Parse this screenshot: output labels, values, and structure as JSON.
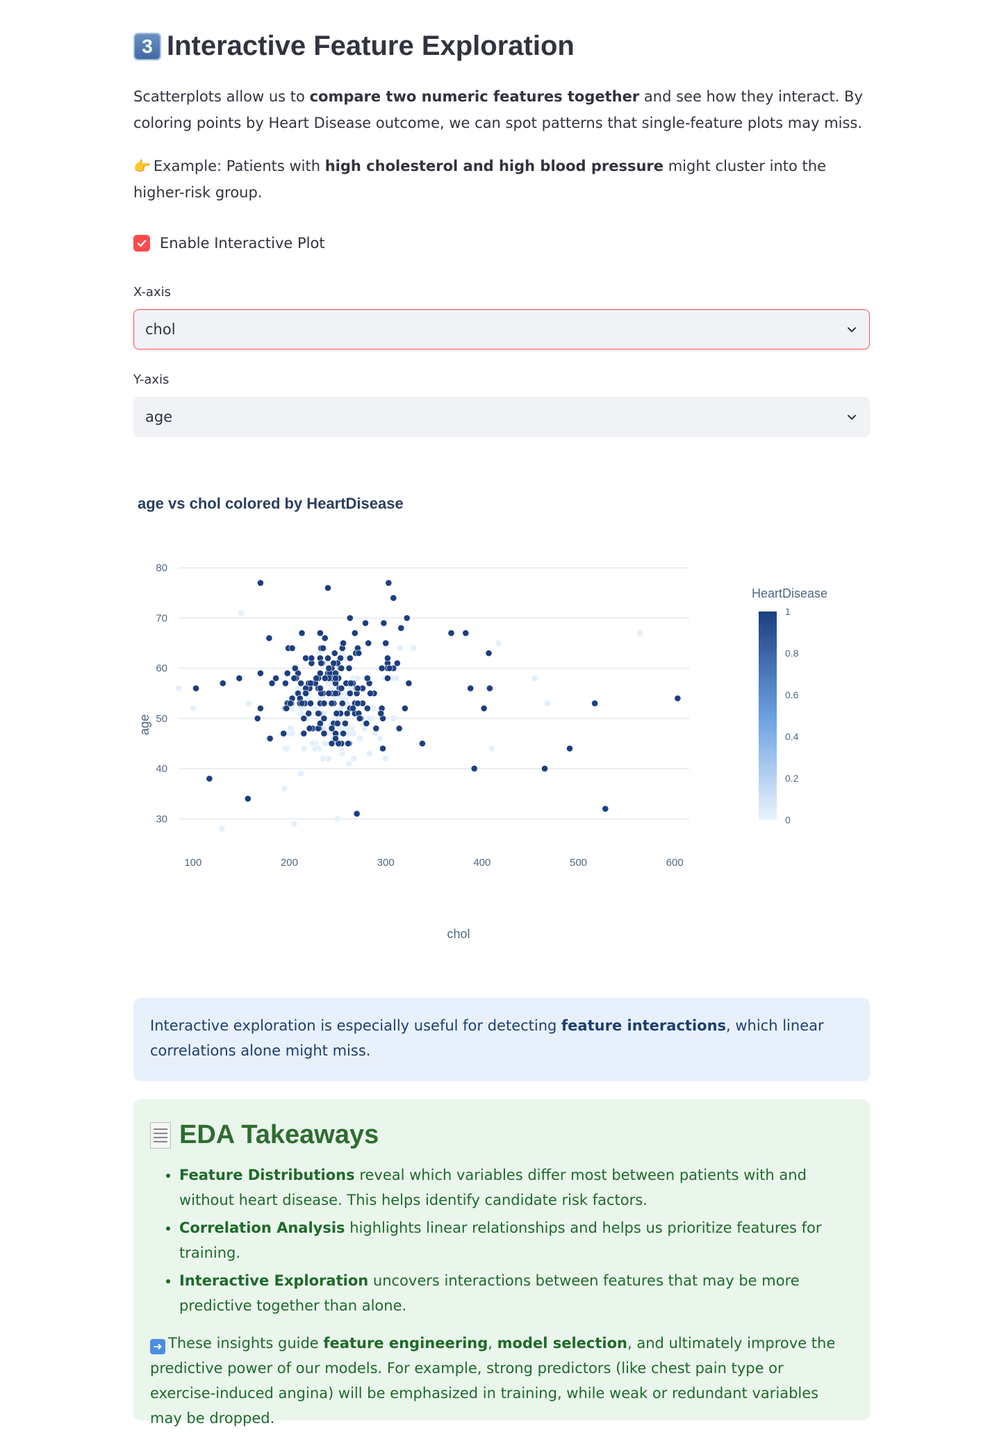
{
  "section": {
    "badge": "3",
    "title": "Interactive Feature Exploration",
    "intro_1": "Scatterplots allow us to ",
    "intro_bold": "compare two numeric features together",
    "intro_2": " and see how they interact. By coloring points by Heart Disease outcome, we can spot patterns that single-feature plots may miss.",
    "example_1": "Example: Patients with ",
    "example_bold": "high cholesterol and high blood pressure",
    "example_2": " might cluster into the higher-risk group."
  },
  "controls": {
    "checkbox_label": "Enable Interactive Plot",
    "checkbox_checked": true,
    "x_label": "X-axis",
    "x_value": "chol",
    "y_label": "Y-axis",
    "y_value": "age"
  },
  "chart_data": {
    "type": "scatter",
    "title": "age vs chol colored by HeartDisease",
    "xlabel": "chol",
    "ylabel": "age",
    "xlim": [
      85,
      615
    ],
    "ylim": [
      27,
      81
    ],
    "x_ticks": [
      100,
      200,
      300,
      400,
      500,
      600
    ],
    "y_ticks": [
      30,
      40,
      50,
      60,
      70,
      80
    ],
    "grid": true,
    "colorbar": {
      "title": "HeartDisease",
      "ticks": [
        "1",
        "0.8",
        "0.6",
        "0.4",
        "0.2",
        "0"
      ],
      "color_low": "#eaf4fd",
      "color_high": "#1d3f80"
    },
    "color_high": "#1d3f80",
    "color_low": "#e3f0fc",
    "outliers": [
      {
        "x": 170,
        "y": 77,
        "c": 1
      },
      {
        "x": 303,
        "y": 77,
        "c": 1
      },
      {
        "x": 240,
        "y": 76,
        "c": 1
      },
      {
        "x": 308,
        "y": 74,
        "c": 1
      },
      {
        "x": 322,
        "y": 70,
        "c": 1
      },
      {
        "x": 368,
        "y": 67,
        "c": 1
      },
      {
        "x": 383,
        "y": 67,
        "c": 1
      },
      {
        "x": 407,
        "y": 63,
        "c": 1
      },
      {
        "x": 388,
        "y": 56,
        "c": 1
      },
      {
        "x": 408,
        "y": 56,
        "c": 1
      },
      {
        "x": 402,
        "y": 52,
        "c": 1
      },
      {
        "x": 103,
        "y": 56,
        "c": 1
      },
      {
        "x": 131,
        "y": 57,
        "c": 1
      },
      {
        "x": 117,
        "y": 38,
        "c": 1
      },
      {
        "x": 392,
        "y": 40,
        "c": 1
      },
      {
        "x": 465,
        "y": 40,
        "c": 1
      },
      {
        "x": 491,
        "y": 44,
        "c": 1
      },
      {
        "x": 517,
        "y": 53,
        "c": 1
      },
      {
        "x": 603,
        "y": 54,
        "c": 1
      },
      {
        "x": 528,
        "y": 32,
        "c": 1
      },
      {
        "x": 157,
        "y": 34,
        "c": 1
      },
      {
        "x": 270,
        "y": 31,
        "c": 1
      },
      {
        "x": 564,
        "y": 67,
        "c": 0
      },
      {
        "x": 410,
        "y": 44,
        "c": 0
      },
      {
        "x": 468,
        "y": 53,
        "c": 0
      },
      {
        "x": 417,
        "y": 65,
        "c": 0
      },
      {
        "x": 455,
        "y": 58,
        "c": 0
      },
      {
        "x": 130,
        "y": 28,
        "c": 0
      },
      {
        "x": 85,
        "y": 56,
        "c": 0
      },
      {
        "x": 100,
        "y": 52,
        "c": 0
      },
      {
        "x": 150,
        "y": 71,
        "c": 0
      },
      {
        "x": 250,
        "y": 30,
        "c": 0
      },
      {
        "x": 205,
        "y": 29,
        "c": 0
      }
    ]
  },
  "info": {
    "text_1": "Interactive exploration is especially useful for detecting ",
    "text_bold": "feature interactions",
    "text_2": ", which linear correlations alone might miss."
  },
  "takeaways": {
    "title": "EDA Takeaways",
    "items": [
      {
        "bold": "Feature Distributions",
        "text": " reveal which variables differ most between patients with and without heart disease. This helps identify candidate risk factors."
      },
      {
        "bold": "Correlation Analysis",
        "text": " highlights linear relationships and helps us prioritize features for training."
      },
      {
        "bold": "Interactive Exploration",
        "text": " uncovers interactions between features that may be more predictive together than alone."
      }
    ],
    "final_1": "These insights guide ",
    "final_b1": "feature engineering",
    "final_sep": ", ",
    "final_b2": "model selection",
    "final_2": ", and ultimately improve the predictive power of our models. For example, strong predictors (like chest pain type or exercise-induced angina) will be emphasized in training, while weak or redundant variables may be dropped."
  }
}
